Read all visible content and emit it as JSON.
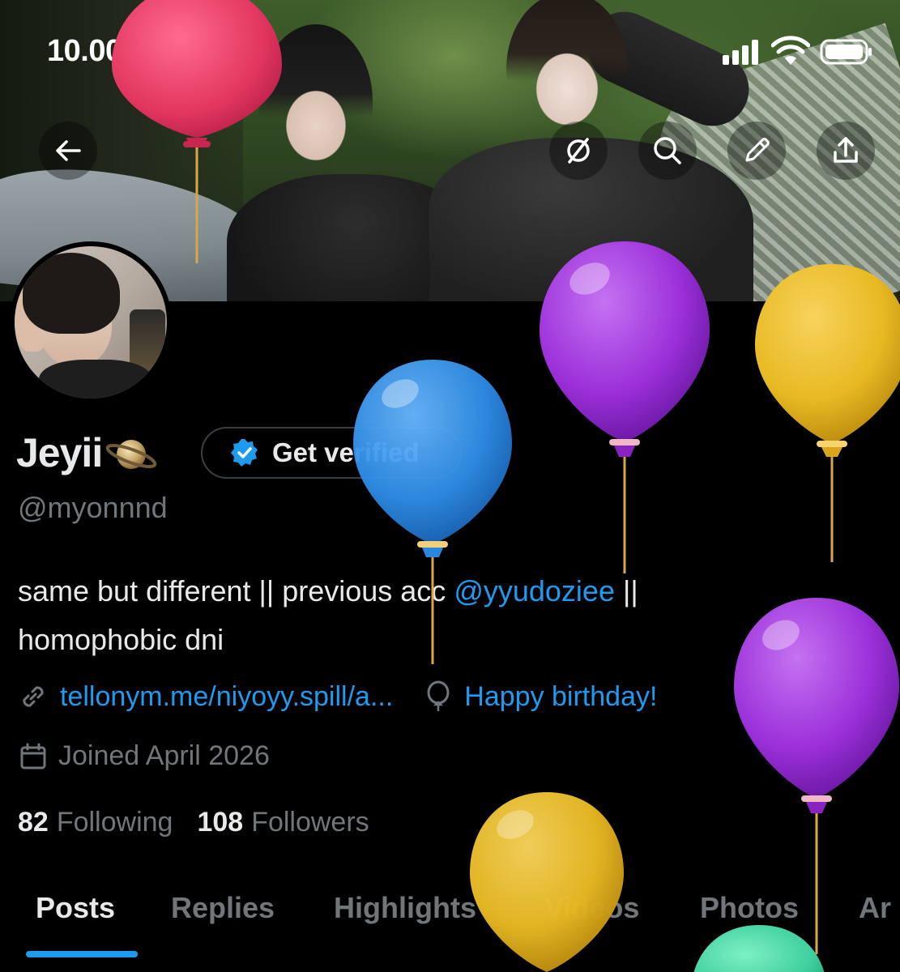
{
  "status_bar": {
    "time": "10.00",
    "icons": [
      "moon-icon",
      "signal-icon",
      "wifi-icon",
      "battery-icon"
    ]
  },
  "top_bar": {
    "buttons": [
      "back-arrow-icon",
      "grok-icon",
      "search-icon",
      "edit-pencil-icon",
      "share-icon"
    ]
  },
  "profile": {
    "name": "Jeyii",
    "name_emoji": "saturn-ringed-planet-icon",
    "verify_button_label": "Get verified",
    "handle": "@myonnnd",
    "bio": {
      "line1_before": "same but different || previous acc ",
      "mention": "@yyudoziee",
      "line1_after": " ||",
      "line2": "homophobic dni"
    },
    "link": "tellonym.me/niyoyy.spill/a...",
    "birthday": "Happy birthday!",
    "joined": "Joined April 2026",
    "following_count": "82",
    "following_label": "Following",
    "followers_count": "108",
    "followers_label": "Followers"
  },
  "tabs": [
    {
      "label": "Posts",
      "active": true
    },
    {
      "label": "Replies",
      "active": false
    },
    {
      "label": "Highlights",
      "active": false
    },
    {
      "label": "Videos",
      "active": false
    },
    {
      "label": "Photos",
      "active": false
    },
    {
      "label": "Ar",
      "active": false
    }
  ],
  "colors": {
    "background": "#000000",
    "text_primary": "#e7e9ea",
    "text_secondary": "#71767b",
    "accent_blue": "#1d9bf0",
    "balloon_red": "#e2365f",
    "balloon_purple": "#9b30d9",
    "balloon_yellow": "#e8b923",
    "balloon_blue": "#2f8fe8",
    "balloon_green": "#3ecf9e"
  }
}
